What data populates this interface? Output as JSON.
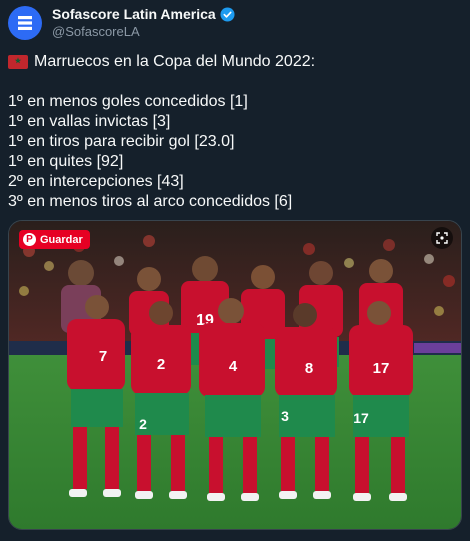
{
  "account": {
    "display_name": "Sofascore Latin America",
    "handle": "@SofascoreLA",
    "avatar_icon": "sofascore-logo-icon",
    "verified_icon": "verified-badge-icon",
    "accent": "#1d9bf0"
  },
  "tweet": {
    "title": "Marruecos en la Copa del Mundo 2022:",
    "flag_icon": "morocco-flag-icon",
    "lines": [
      "1º en menos goles concedidos [1]",
      "1º en vallas invictas [3]",
      "1º en tiros para recibir gol [23.0]",
      "1º en quites [92]",
      "2º en intercepciones [43]",
      "3º en menos tiros al arco concedidos [6]"
    ]
  },
  "media": {
    "save_label": "Guardar",
    "save_icon": "pinterest-icon",
    "lens_icon": "visual-search-icon",
    "jersey_numbers": [
      "19",
      "7",
      "2",
      "4",
      "8",
      "17",
      "3",
      "17",
      "2"
    ]
  },
  "colors": {
    "background": "#15202b",
    "jersey_red": "#c8102e",
    "shorts_green": "#1f8a4c",
    "pinterest_red": "#e60023"
  }
}
